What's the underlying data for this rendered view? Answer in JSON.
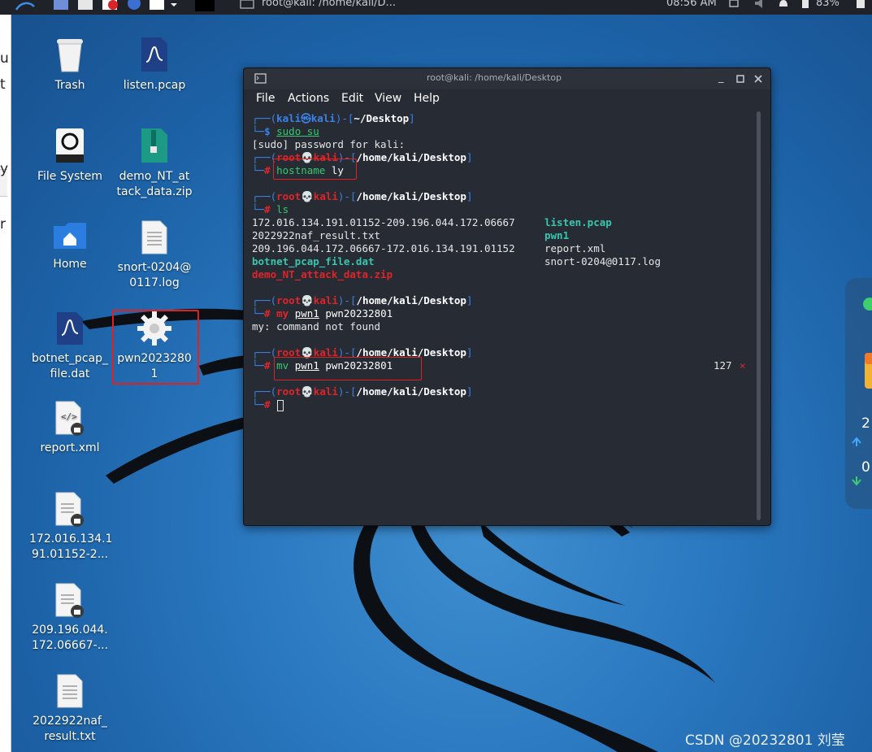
{
  "top_panel": {
    "window_title": "root@kali: /home/kali/D...",
    "clock": "08:56 AM",
    "battery": "83%"
  },
  "left_strip": {
    "chars": [
      "u",
      "t",
      "y",
      "r"
    ]
  },
  "desktop_icons": [
    {
      "label": "Trash",
      "icon": "trash-icon"
    },
    {
      "label": "listen.pcap",
      "icon": "pcap-file-icon"
    },
    {
      "label": "File System",
      "icon": "drive-icon"
    },
    {
      "label": "demo_NT_attack_data.zip",
      "label_lines": [
        "demo_NT_at",
        "tack_data.zip"
      ],
      "icon": "zip-file-icon"
    },
    {
      "label": "Home",
      "icon": "home-folder-icon"
    },
    {
      "label": "snort-0204@0117.log",
      "label_lines": [
        "snort-0204@",
        "0117.log"
      ],
      "icon": "text-file-icon"
    },
    {
      "label": "botnet_pcap_file.dat",
      "label_lines": [
        "botnet_pcap_",
        "file.dat"
      ],
      "icon": "pcap-file-icon"
    },
    {
      "label": "pwn20232801",
      "label_lines": [
        "pwn2023280",
        "1"
      ],
      "icon": "gear-icon"
    },
    {
      "label": "report.xml",
      "icon": "xml-file-icon"
    },
    {
      "label": "172.016.134.191.01152-2...",
      "label_lines": [
        "172.016.134.1",
        "91.01152-2..."
      ],
      "icon": "locked-file-icon"
    },
    {
      "label": "209.196.044.172.06667-...",
      "label_lines": [
        "209.196.044.",
        "172.06667-..."
      ],
      "icon": "locked-file-icon"
    },
    {
      "label": "2022922naf_result.txt",
      "label_lines": [
        "2022922naf_",
        "result.txt"
      ],
      "icon": "text-file-icon"
    }
  ],
  "side_widget": {
    "values": [
      "2",
      "0"
    ]
  },
  "terminal": {
    "title": "root@kali: /home/kali/Desktop",
    "menu": [
      "File",
      "Actions",
      "Edit",
      "View",
      "Help"
    ],
    "user_prompt": {
      "user": "kali",
      "host": "kali",
      "dir": "~/Desktop",
      "symbol": "$"
    },
    "root_prompt": {
      "user": "root",
      "host": "kali",
      "dir": "/home/kali/Desktop",
      "symbol": "#"
    },
    "commands": {
      "c1": "sudo su",
      "c1_out": "[sudo] password for kali:",
      "c2_cmd": "hostname",
      "c2_arg": "ly",
      "c3": "ls",
      "ls_left": [
        "172.016.134.191.01152-209.196.044.172.06667",
        "2022922naf_result.txt",
        "209.196.044.172.06667-172.016.134.191.01152",
        "botnet_pcap_file.dat",
        "demo_NT_attack_data.zip"
      ],
      "ls_right": [
        "listen.pcap",
        "pwn1",
        "report.xml",
        "snort-0204@0117.log"
      ],
      "c4_cmd": "my",
      "c4_arg1": "pwn1",
      "c4_arg2": "pwn20232801",
      "c4_out": "my: command not found",
      "c5_cmd": "mv",
      "c5_arg1": "pwn1",
      "c5_arg2": "pwn20232801",
      "exit_code": "127",
      "exit_mark": "×"
    }
  },
  "watermark": "CSDN @20232801 刘莹"
}
